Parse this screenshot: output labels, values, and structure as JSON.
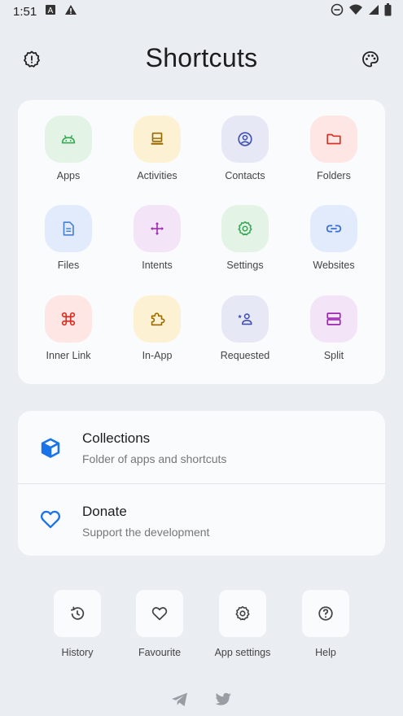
{
  "status": {
    "time": "1:51"
  },
  "header": {
    "title": "Shortcuts"
  },
  "grid": {
    "items": [
      {
        "label": "Apps",
        "icon": "android-icon",
        "tile_color": "#e3f3e6",
        "icon_color": "#34a853"
      },
      {
        "label": "Activities",
        "icon": "activities-icon",
        "tile_color": "#fdf1d3",
        "icon_color": "#9a6a00"
      },
      {
        "label": "Contacts",
        "icon": "contact-icon",
        "tile_color": "#e6e8f6",
        "icon_color": "#3f51b5"
      },
      {
        "label": "Folders",
        "icon": "folder-icon",
        "tile_color": "#fde6e4",
        "icon_color": "#d93025"
      },
      {
        "label": "Files",
        "icon": "file-icon",
        "tile_color": "#e2ebfb",
        "icon_color": "#4a7fd6"
      },
      {
        "label": "Intents",
        "icon": "move-arrows-icon",
        "tile_color": "#f4e4f8",
        "icon_color": "#9c27b0"
      },
      {
        "label": "Settings",
        "icon": "gear-icon",
        "tile_color": "#e3f3e6",
        "icon_color": "#34a853"
      },
      {
        "label": "Websites",
        "icon": "link-icon",
        "tile_color": "#e2ebfb",
        "icon_color": "#3b6fd6"
      },
      {
        "label": "Inner Link",
        "icon": "command-icon",
        "tile_color": "#fde6e4",
        "icon_color": "#d93025"
      },
      {
        "label": "In-App",
        "icon": "puzzle-icon",
        "tile_color": "#fdf1d3",
        "icon_color": "#9a6a00"
      },
      {
        "label": "Requested",
        "icon": "person-star-icon",
        "tile_color": "#e6e8f6",
        "icon_color": "#3f51b5"
      },
      {
        "label": "Split",
        "icon": "split-icon",
        "tile_color": "#f4e4f8",
        "icon_color": "#9c27b0"
      }
    ]
  },
  "list": {
    "collections": {
      "title": "Collections",
      "subtitle": "Folder of apps and shortcuts"
    },
    "donate": {
      "title": "Donate",
      "subtitle": "Support the development"
    }
  },
  "bottom": {
    "items": [
      {
        "label": "History",
        "icon": "history-icon"
      },
      {
        "label": "Favourite",
        "icon": "heart-icon"
      },
      {
        "label": "App settings",
        "icon": "gear-icon"
      },
      {
        "label": "Help",
        "icon": "help-icon"
      }
    ]
  },
  "colors": {
    "accent": "#1a73e8",
    "background": "#eaedf2",
    "card": "#fafbfd"
  }
}
